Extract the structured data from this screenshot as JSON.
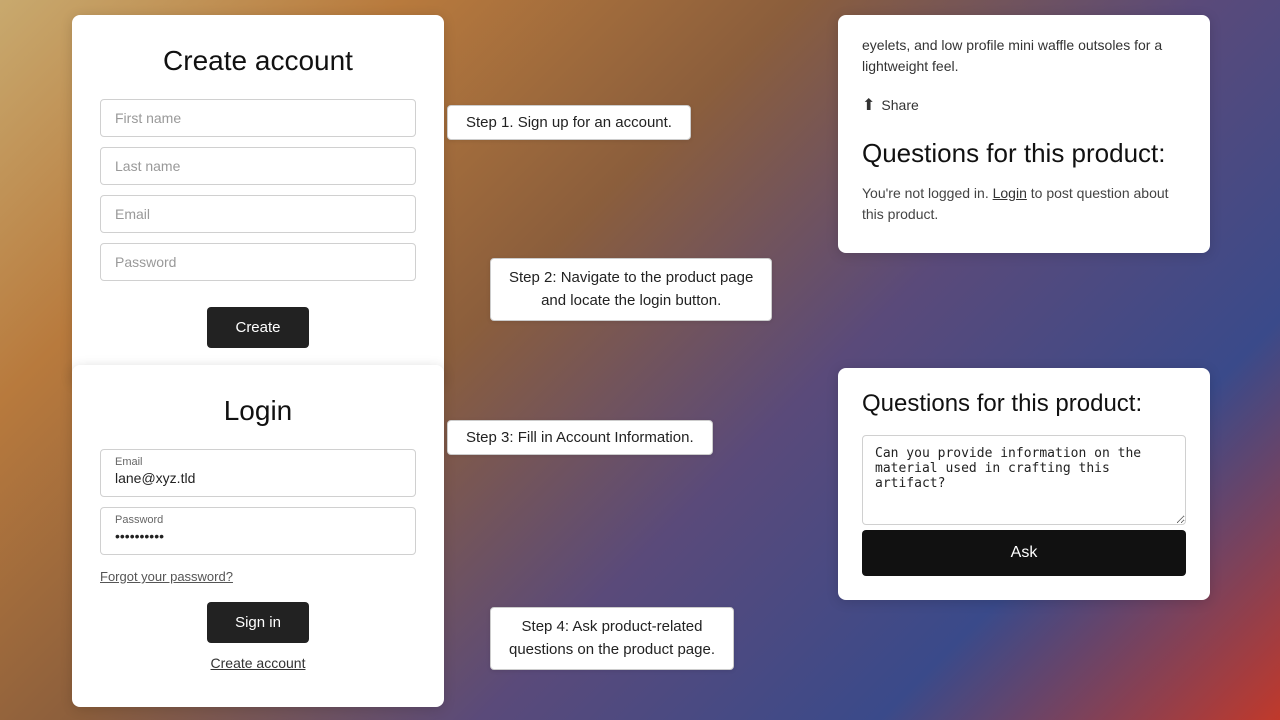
{
  "createAccount": {
    "title": "Create account",
    "firstNamePlaceholder": "First name",
    "lastNamePlaceholder": "Last name",
    "emailPlaceholder": "Email",
    "passwordPlaceholder": "Password",
    "createButtonLabel": "Create"
  },
  "login": {
    "title": "Login",
    "emailLabel": "Email",
    "emailValue": "lane@xyz.tld",
    "passwordLabel": "Password",
    "passwordValue": "••••••••••",
    "signInButtonLabel": "Sign in",
    "forgotPasswordLabel": "Forgot your password?",
    "createAccountLabel": "Create account"
  },
  "steps": {
    "step1": "Step 1. Sign up for an account.",
    "step2": "Step 2: Navigate to the product page\nand locate the login button.",
    "step3": "Step 3: Fill in Account Information.",
    "step4": "Step 4: Ask product-related\nquestions on the product page."
  },
  "productCard1": {
    "description": "eyelets, and low profile mini waffle outsoles for a lightweight feel.",
    "shareLabel": "Share",
    "questionsTitle": "Questions for this product:",
    "notLoggedInText": "You're not logged in.",
    "loginLinkText": "Login",
    "postQuestionText": "to post question about this product."
  },
  "productCard2": {
    "questionsTitle": "Questions for this product:",
    "questionText": "Can you provide information on the material used in crafting this artifact?",
    "askButtonLabel": "Ask"
  },
  "colors": {
    "darkButton": "#222222",
    "cardBg": "#ffffff"
  }
}
